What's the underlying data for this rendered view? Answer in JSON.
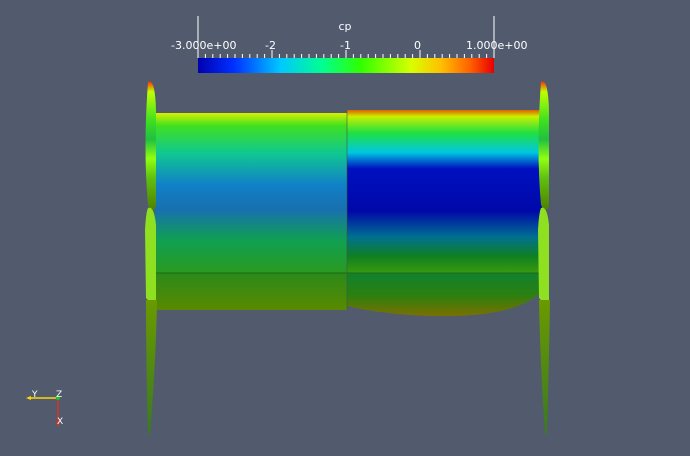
{
  "colorbar": {
    "title": "cp",
    "labels": [
      "-3.000e+00",
      "-2",
      "-1",
      "0",
      "1.000e+00"
    ],
    "min": -3.0,
    "max": 1.0,
    "colormap": [
      "#0000b0",
      "#0050ff",
      "#00d8ff",
      "#00ff90",
      "#40ff00",
      "#c8ff00",
      "#ffd000",
      "#ff7000",
      "#e80000"
    ]
  },
  "axes_triad": {
    "labels": [
      "Y",
      "Z",
      "X"
    ],
    "colors": {
      "y": "#ffd700",
      "z": "#22c022",
      "x": "#e03020"
    }
  },
  "background": "#525b6e"
}
